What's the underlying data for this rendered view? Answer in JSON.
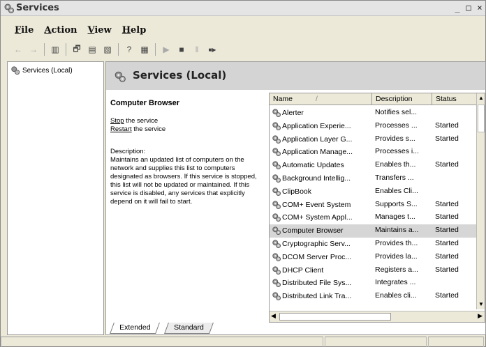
{
  "window": {
    "title": "Services",
    "controls": [
      "_",
      "□",
      "×"
    ]
  },
  "menu": [
    "File",
    "Action",
    "View",
    "Help"
  ],
  "toolbar": [
    {
      "icon": "back-arrow-icon",
      "glyph": "←",
      "enabled": false
    },
    {
      "icon": "forward-arrow-icon",
      "glyph": "→",
      "enabled": false
    },
    {
      "icon": "show-hide-tree-icon",
      "glyph": "▥",
      "enabled": true
    },
    {
      "icon": "properties-icon",
      "glyph": "🗗",
      "enabled": true
    },
    {
      "icon": "refresh-icon",
      "glyph": "▤",
      "enabled": true
    },
    {
      "icon": "export-list-icon",
      "glyph": "▧",
      "enabled": true
    },
    {
      "icon": "help-icon",
      "glyph": "?",
      "enabled": true
    },
    {
      "icon": "view-icon",
      "glyph": "▦",
      "enabled": true
    },
    {
      "icon": "start-service-icon",
      "glyph": "▶",
      "enabled": false
    },
    {
      "icon": "stop-service-icon",
      "glyph": "■",
      "enabled": true
    },
    {
      "icon": "pause-service-icon",
      "glyph": "‖",
      "enabled": false
    },
    {
      "icon": "restart-service-icon",
      "glyph": "■▶",
      "enabled": true
    }
  ],
  "tree": {
    "root": "Services (Local)"
  },
  "panel": {
    "header": "Services (Local)",
    "selected_title": "Computer Browser",
    "stop_link": "Stop",
    "stop_rest": " the service",
    "restart_link": "Restart",
    "restart_rest": " the service",
    "description_label": "Description:",
    "description": "Maintains an updated list of computers on the network and supplies this list to computers designated as browsers. If this service is stopped, this list will not be updated or maintained. If this service is disabled, any services that explicitly depend on it will fail to start."
  },
  "list": {
    "columns": [
      "Name",
      "Description",
      "Status"
    ],
    "sort_indicator": "/",
    "rows": [
      {
        "name": "Alerter",
        "description": "Notifies sel...",
        "status": ""
      },
      {
        "name": "Application Experie...",
        "description": "Processes ...",
        "status": "Started"
      },
      {
        "name": "Application Layer G...",
        "description": "Provides s...",
        "status": "Started"
      },
      {
        "name": "Application Manage...",
        "description": "Processes i...",
        "status": ""
      },
      {
        "name": "Automatic Updates",
        "description": "Enables th...",
        "status": "Started"
      },
      {
        "name": "Background Intellig...",
        "description": "Transfers ...",
        "status": ""
      },
      {
        "name": "ClipBook",
        "description": "Enables Cli...",
        "status": ""
      },
      {
        "name": "COM+ Event System",
        "description": "Supports S...",
        "status": "Started"
      },
      {
        "name": "COM+ System Appl...",
        "description": "Manages t...",
        "status": "Started"
      },
      {
        "name": "Computer Browser",
        "description": "Maintains a...",
        "status": "Started",
        "selected": true
      },
      {
        "name": "Cryptographic Serv...",
        "description": "Provides th...",
        "status": "Started"
      },
      {
        "name": "DCOM Server Proc...",
        "description": "Provides la...",
        "status": "Started"
      },
      {
        "name": "DHCP Client",
        "description": "Registers a...",
        "status": "Started"
      },
      {
        "name": "Distributed File Sys...",
        "description": "Integrates ...",
        "status": ""
      },
      {
        "name": "Distributed Link Tra...",
        "description": "Enables cli...",
        "status": "Started"
      }
    ]
  },
  "tabs": [
    "Extended",
    "Standard"
  ],
  "colors": {
    "selection": "#d6d6d6",
    "header_band": "#d4d4d4",
    "chrome": "#ece9d8"
  }
}
